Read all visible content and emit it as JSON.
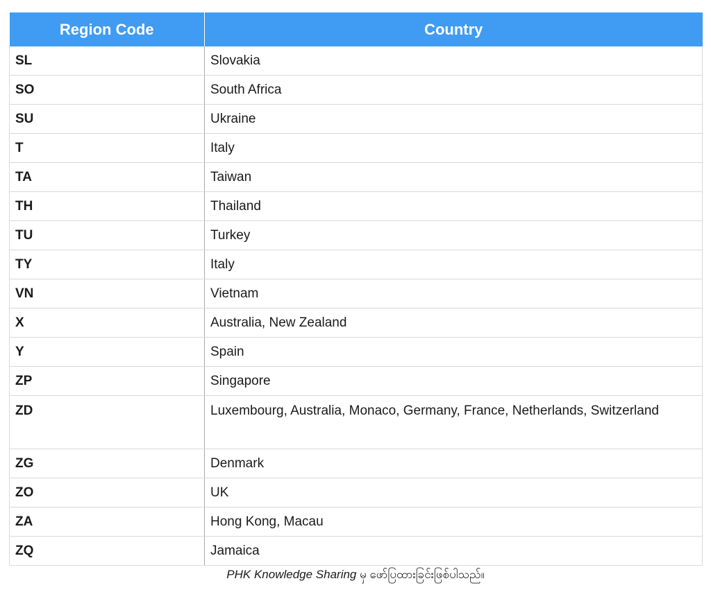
{
  "table": {
    "headers": [
      "Region Code",
      "Country"
    ],
    "rows": [
      {
        "code": "SL",
        "country": "Slovakia"
      },
      {
        "code": "SO",
        "country": "South Africa"
      },
      {
        "code": "SU",
        "country": "Ukraine"
      },
      {
        "code": "T",
        "country": "Italy"
      },
      {
        "code": "TA",
        "country": "Taiwan"
      },
      {
        "code": "TH",
        "country": "Thailand"
      },
      {
        "code": "TU",
        "country": "Turkey"
      },
      {
        "code": "TY",
        "country": "Italy"
      },
      {
        "code": "VN",
        "country": "Vietnam"
      },
      {
        "code": "X",
        "country": "Australia, New Zealand"
      },
      {
        "code": "Y",
        "country": "Spain"
      },
      {
        "code": "ZP",
        "country": "Singapore"
      },
      {
        "code": "ZD",
        "country": "Luxembourg, Australia, Monaco, Germany, France, Netherlands, Switzerland"
      },
      {
        "code": "ZG",
        "country": "Denmark"
      },
      {
        "code": "ZO",
        "country": "UK"
      },
      {
        "code": "ZA",
        "country": "Hong Kong, Macau"
      },
      {
        "code": "ZQ",
        "country": "Jamaica"
      }
    ]
  },
  "caption": {
    "brand": "PHK Knowledge Sharing",
    "rest": " မှ ဖော်ပြထားခြင်းဖြစ်ပါသည်။"
  },
  "colors": {
    "header_bg": "#3f9cf2",
    "header_text": "#ffffff"
  }
}
